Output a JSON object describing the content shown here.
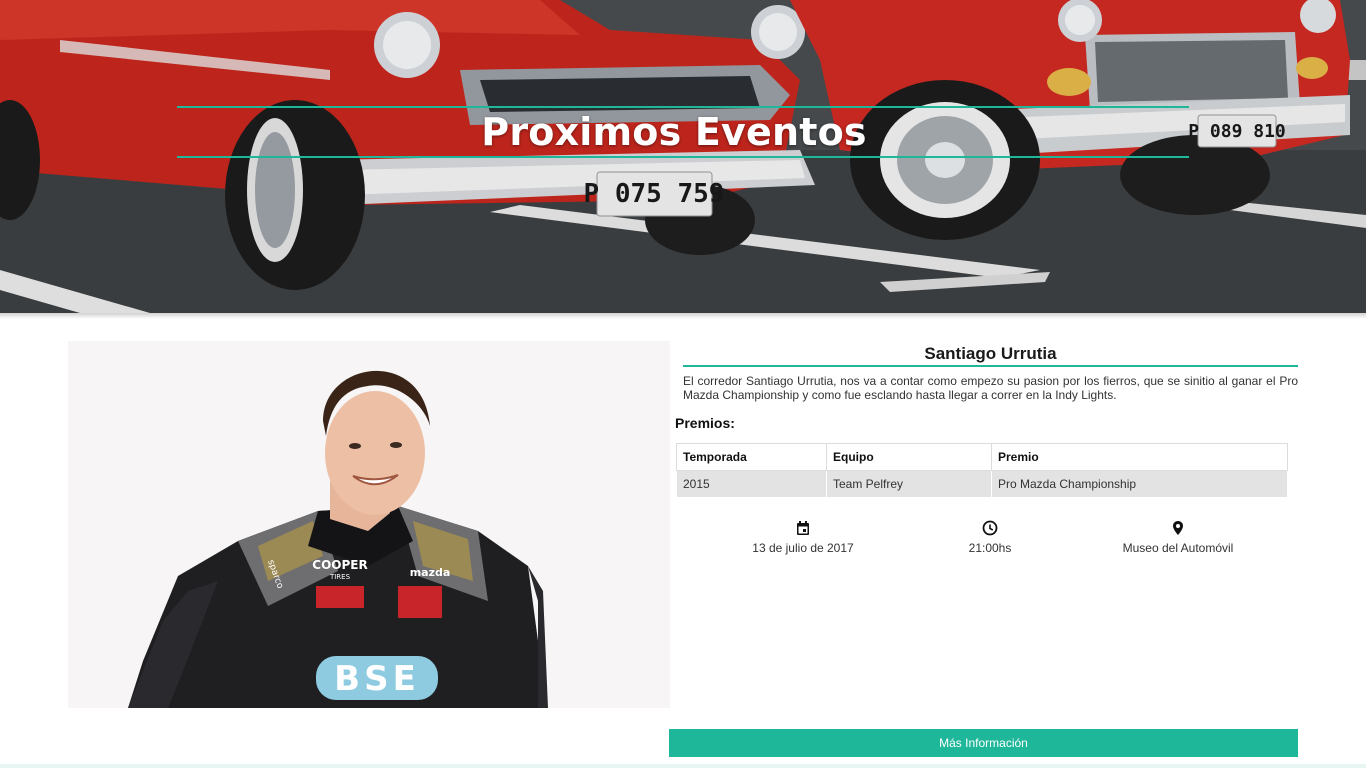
{
  "hero": {
    "title": "Proximos Eventos",
    "accent_color": "#1fb79a",
    "plate_left": "P 075 759",
    "plate_right": "P 089 810"
  },
  "event": {
    "name": "Santiago Urrutia",
    "description": "El corredor Santiago Urrutia, nos va a contar como empezo su pasion por los fierros, que se sinitio al ganar el Pro Mazda Championship y como fue esclando hasta llegar a correr en la Indy Lights.",
    "awards_label": "Premios:",
    "awards_table": {
      "headers": [
        "Temporada",
        "Equipo",
        "Premio"
      ],
      "rows": [
        [
          "2015",
          "Team Pelfrey",
          "Pro Mazda Championship"
        ]
      ]
    },
    "date": "13 de julio de 2017",
    "time": "21:00hs",
    "location": "Museo del Automóvil",
    "date_icon": "calendar-icon",
    "time_icon": "clock-icon",
    "location_icon": "map-pin-icon",
    "more_button": "Más Información"
  },
  "photo_suit": {
    "brand_cooper": "COOPER",
    "brand_tires": "TIRES",
    "brand_mazda": "mazda",
    "brand_bse": "BSE",
    "brand_sparco": "sparco"
  }
}
